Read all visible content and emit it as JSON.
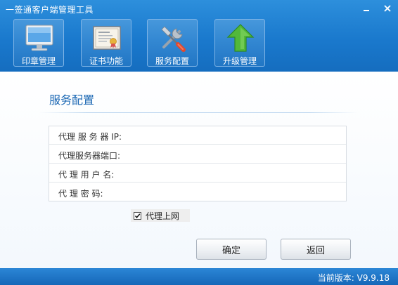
{
  "window": {
    "title": "一签通客户端管理工具"
  },
  "toolbar": {
    "items": [
      {
        "label": "印章管理",
        "icon": "monitor-icon"
      },
      {
        "label": "证书功能",
        "icon": "certificate-icon"
      },
      {
        "label": "服务配置",
        "icon": "wrench-screwdriver-icon"
      },
      {
        "label": "升级管理",
        "icon": "up-arrow-icon"
      }
    ]
  },
  "section": {
    "title": "服务配置"
  },
  "form": {
    "rows": [
      {
        "label": "代理 服 务 器 IP:",
        "value": "",
        "placeholder": ""
      },
      {
        "label": "代理服务器端口:",
        "value": "",
        "placeholder": ""
      },
      {
        "label": "代 理 用 户 名:",
        "value": "",
        "placeholder": ""
      },
      {
        "label": "代   理   密   码:",
        "value": "",
        "placeholder": ""
      }
    ]
  },
  "proxy": {
    "label": "代理上网",
    "checked": true
  },
  "buttons": {
    "ok": "确定",
    "back": "返回"
  },
  "status": {
    "version": "当前版本: V9.9.18"
  },
  "colors": {
    "header": "#1a79cd",
    "accent": "#1c68b4",
    "arrow": "#52b83a"
  }
}
